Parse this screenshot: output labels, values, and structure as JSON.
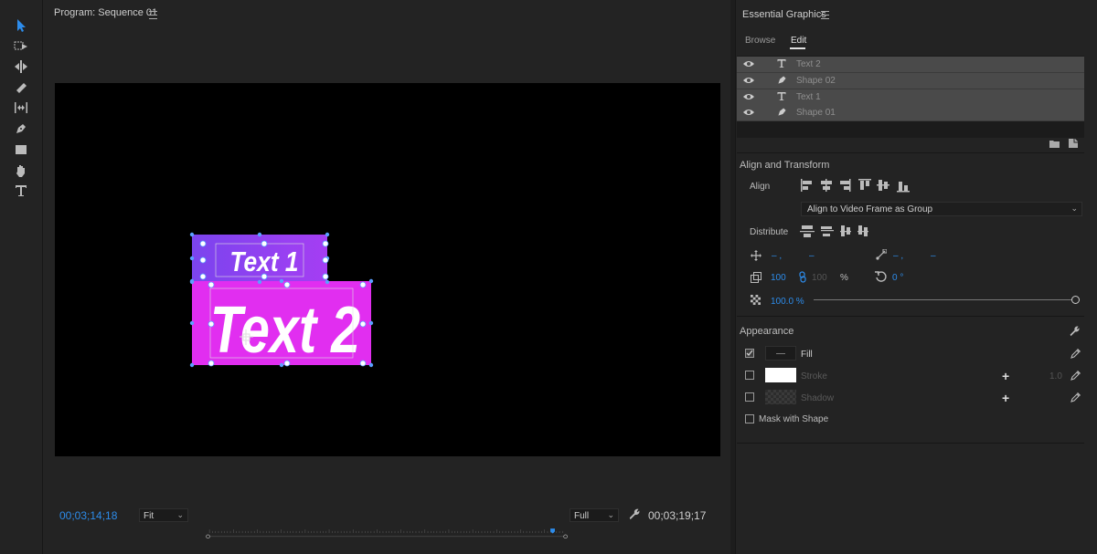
{
  "program": {
    "title": "Program: Sequence 01",
    "timecode_current": "00;03;14;18",
    "timecode_duration": "00;03;19;17",
    "fit_label": "Fit",
    "full_label": "Full",
    "playhead_fraction": 0.964
  },
  "canvas": {
    "shape01_color": "#9a3df2",
    "shape02_color": "#e12ef0",
    "text1": "Text 1",
    "text2": "Text 2"
  },
  "essential_graphics": {
    "title": "Essential Graphics",
    "tabs": [
      "Browse",
      "Edit"
    ],
    "active_tab": "Edit",
    "layers": [
      {
        "name": "Text 2",
        "type": "text"
      },
      {
        "name": "Shape 02",
        "type": "shape"
      },
      {
        "name": "Text 1",
        "type": "text"
      },
      {
        "name": "Shape 01",
        "type": "shape"
      }
    ],
    "align_transform": {
      "title": "Align and Transform",
      "align_label": "Align",
      "align_mode": "Align to Video Frame as Group",
      "distribute_label": "Distribute",
      "pos_x": "– ,",
      "pos_y": "–",
      "anchor_x": "– ,",
      "anchor_y": "–",
      "scale": "100",
      "scale2": "100",
      "scale_unit": "%",
      "rotation": "0 °",
      "opacity": "100.0 %",
      "opacity_fraction": 1.0
    },
    "appearance": {
      "title": "Appearance",
      "fill_label": "Fill",
      "fill_checked": true,
      "stroke_label": "Stroke",
      "stroke_checked": false,
      "stroke_width": "1.0",
      "shadow_label": "Shadow",
      "shadow_checked": false,
      "mask_label": "Mask with Shape",
      "mask_checked": false,
      "stroke_color": "#ffffff"
    }
  },
  "colors": {
    "accent": "#2d8ceb",
    "panel_bg": "#232323"
  }
}
